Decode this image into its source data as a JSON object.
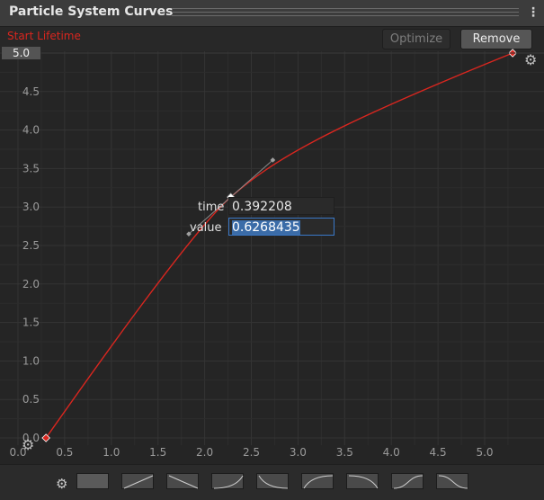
{
  "window": {
    "title": "Particle System Curves",
    "menu_icon": "kebab-menu-icon"
  },
  "toolbar": {
    "optimize_label": "Optimize",
    "remove_label": "Remove",
    "optimize_enabled": false
  },
  "curve": {
    "name": "Start Lifetime",
    "max_value": "5.0",
    "color": "#d9261f"
  },
  "key_editor": {
    "time_label": "time",
    "time_value": "0.392208",
    "value_label": "value",
    "value_value": "0.6268435"
  },
  "chart_data": {
    "type": "line",
    "x_ticks": [
      "0.0",
      "0.5",
      "1.0",
      "1.5",
      "2.0",
      "2.5",
      "3.0",
      "3.5",
      "4.0",
      "4.5",
      "5.0"
    ],
    "y_ticks": [
      "0.0",
      "0.5",
      "1.0",
      "1.5",
      "2.0",
      "2.5",
      "3.0",
      "3.5",
      "4.0",
      "4.5",
      "5.0"
    ],
    "xlim": [
      0,
      5.3
    ],
    "ylim": [
      0,
      5.0
    ],
    "keys": [
      {
        "x": 0.3,
        "y": 0.0
      },
      {
        "x": 2.28,
        "y": 3.13
      },
      {
        "x": 5.3,
        "y": 5.0
      }
    ],
    "selected_key_index": 1,
    "tangent_handles": [
      {
        "x": 1.83,
        "y": 2.65
      },
      {
        "x": 2.73,
        "y": 3.61
      }
    ],
    "grid": true
  },
  "icons": {
    "settings": "gear-icon"
  },
  "presets": [
    {
      "name": "flat"
    },
    {
      "name": "linear-rising"
    },
    {
      "name": "linear-falling"
    },
    {
      "name": "ease-in"
    },
    {
      "name": "ease-out-falling"
    },
    {
      "name": "ease-out"
    },
    {
      "name": "ease-in-falling"
    },
    {
      "name": "ease-in-out"
    },
    {
      "name": "ease-in-out-falling"
    }
  ]
}
